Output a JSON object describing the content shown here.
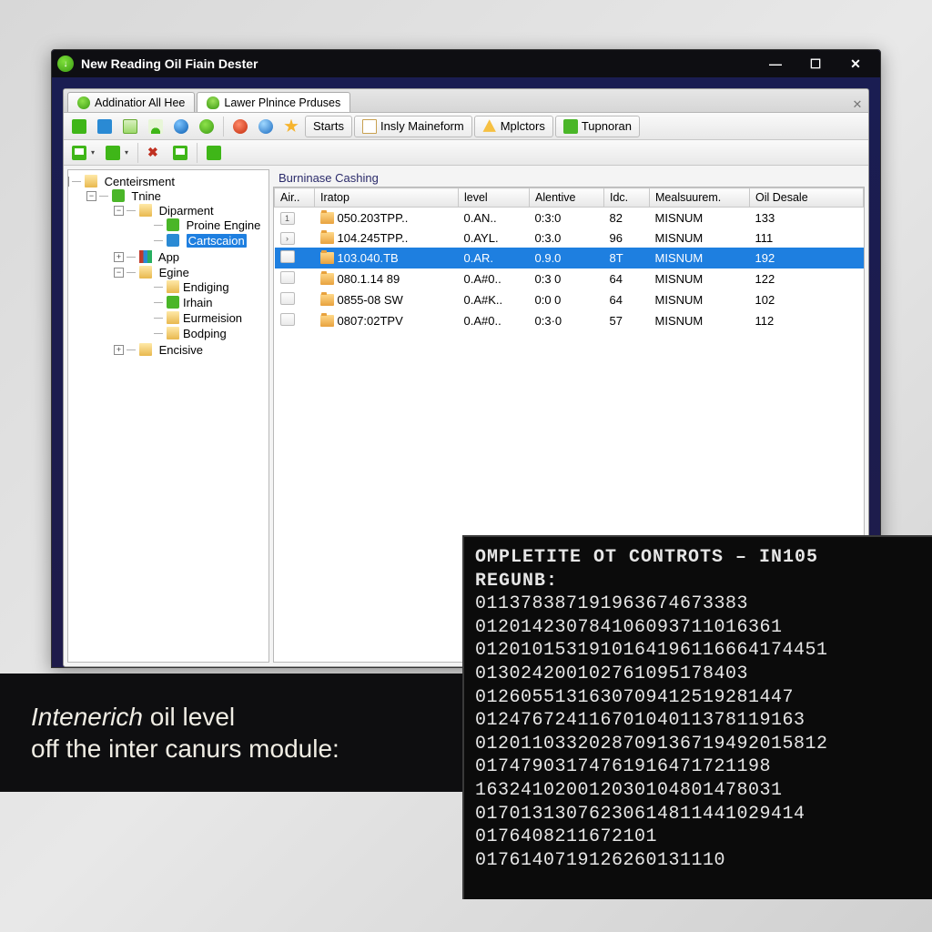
{
  "titlebar": {
    "title": "New Reading Oil Fiain Dester"
  },
  "doc_tabs": [
    {
      "label": "Addinatior   All Hee",
      "active": false,
      "icon": "ico-green"
    },
    {
      "label": "Lawer Plnince   Prduses",
      "active": true,
      "icon": "ico-person"
    }
  ],
  "toolbar": {
    "starts": "Starts",
    "mainform": "Insly Maineform",
    "mplctors": "Mplctors",
    "tupnoran": "Tupnoran"
  },
  "tree": {
    "root": "Centeirsment",
    "nodes": [
      {
        "label": "Tnine",
        "icon": "ico-g",
        "expanded": true,
        "children": [
          {
            "label": "Diparment",
            "icon": "ico-folder",
            "expanded": true,
            "children": [
              {
                "label": "Proine Engine",
                "icon": "ico-g"
              },
              {
                "label": "Cartscaion",
                "icon": "ico-b",
                "selected": true
              }
            ]
          },
          {
            "label": "App",
            "icon": "ico-books"
          },
          {
            "label": "Egine",
            "icon": "ico-folder",
            "expanded": true,
            "children": [
              {
                "label": "Endiging",
                "icon": "ico-folder"
              },
              {
                "label": "Irhain",
                "icon": "ico-g"
              },
              {
                "label": "Eurmeision",
                "icon": "ico-folder"
              },
              {
                "label": "Bodping",
                "icon": "ico-folder"
              }
            ]
          },
          {
            "label": "Encisive",
            "icon": "ico-folder"
          }
        ]
      }
    ]
  },
  "list": {
    "group": "Burninase Cashing",
    "columns": [
      "Air..",
      "Iratop",
      "level",
      "Alentive",
      "Idc.",
      "Mealsuurem.",
      "Oil Desale"
    ],
    "rows": [
      {
        "h": "1",
        "iratop": "050.203TPP..",
        "level": "0.AN..",
        "alentive": "0:3:0",
        "idc": "82",
        "meas": "MISNUM",
        "oil": "133",
        "selected": false
      },
      {
        "h": "›",
        "iratop": "104.245TPP..",
        "level": "0.AYL.",
        "alentive": "0:3.0",
        "idc": "96",
        "meas": "MISNUM",
        "oil": "111",
        "selected": false
      },
      {
        "h": " ",
        "iratop": "103.040.TB",
        "level": "0.AR.",
        "alentive": "0.9.0",
        "idc": "8T",
        "meas": "MISNUM",
        "oil": "192",
        "selected": true
      },
      {
        "h": " ",
        "iratop": "080.1.14 89",
        "level": "0.A#0..",
        "alentive": "0:3 0",
        "idc": "64",
        "meas": "MISNUM",
        "oil": "122",
        "selected": false
      },
      {
        "h": " ",
        "iratop": "0855-08 SW",
        "level": "0.A#K..",
        "alentive": "0:0 0",
        "idc": "64",
        "meas": "MISNUM",
        "oil": "102",
        "selected": false
      },
      {
        "h": " ",
        "iratop": "0807:02TPV",
        "level": "0.A#0..",
        "alentive": "0:3·0",
        "idc": "57",
        "meas": "MISNUM",
        "oil": "112",
        "selected": false
      }
    ]
  },
  "caption": {
    "line1_em": "Intenerich",
    "line1_rest": " oil level",
    "line2": "off the inter canurs module:"
  },
  "console": {
    "title": "OMPLETITE OT CONTROTS – IN105",
    "sub": "REGUNB:",
    "lines": [
      "011378387191963674673383",
      "012014230784106093711016361",
      "0120101531910164196116664174451",
      "013024200102761095178403",
      "0126055131630709412519281447",
      "01247672411670104011378119163",
      "0120110332028709136719492015812",
      "01747903174761916471721198",
      "163241020012030104801478031",
      "01701313076230614811441029414",
      "0176408211672101",
      "0176140719126260131110"
    ]
  }
}
